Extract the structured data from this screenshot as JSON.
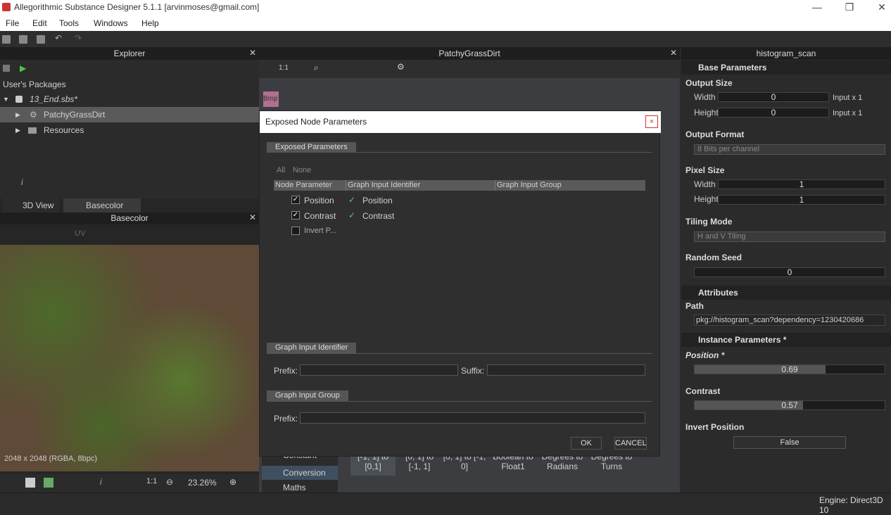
{
  "window": {
    "title": "Allegorithmic Substance Designer 5.1.1 [arvinmoses@gmail.com]"
  },
  "menu": [
    "File",
    "Edit",
    "Tools",
    "Windows",
    "Help"
  ],
  "explorer": {
    "title": "Explorer",
    "users_packages": "User's Packages",
    "package": "13_End.sbs*",
    "graph": "PatchyGrassDirt",
    "resources": "Resources"
  },
  "graph_view": {
    "title": "PatchyGrassDirt",
    "zoom_ratio": "1:1",
    "node_label": "Bmp"
  },
  "view2d": {
    "tab_3d": "3D View",
    "tab_basecolor": "Basecolor",
    "title": "Basecolor",
    "uv_label": "UV",
    "image_info": "2048 x 2048 (RGBA, 8bpc)",
    "zoom_ratio": "1:1",
    "zoom": "23.26%",
    "info_i": "i"
  },
  "library": {
    "items": [
      "Constant",
      "Conversion",
      "Maths"
    ],
    "tiles": [
      {
        "line1": "[-1, 1] to",
        "line2": "[0,1]"
      },
      {
        "line1": "[0, 1] to",
        "line2": "[-1, 1]"
      },
      {
        "line1": "[0, 1] to [-1,",
        "line2": "0]"
      },
      {
        "line1": "Boolean to",
        "line2": "Float1"
      },
      {
        "line1": "Degrees to",
        "line2": "Radians"
      },
      {
        "line1": "Degrees to",
        "line2": "Turns"
      }
    ]
  },
  "properties": {
    "title": "histogram_scan",
    "base_parameters": "Base Parameters",
    "output_size": {
      "label": "Output Size",
      "width_label": "Width",
      "width_value": "0",
      "width_suffix": "Input x 1",
      "height_label": "Height",
      "height_value": "0",
      "height_suffix": "Input x 1"
    },
    "output_format": {
      "label": "Output Format",
      "value": "8 Bits per channel"
    },
    "pixel_size": {
      "label": "Pixel Size",
      "width_label": "Width",
      "width_value": "1",
      "height_label": "Height",
      "height_value": "1"
    },
    "tiling_mode": {
      "label": "Tiling Mode",
      "value": "H and V Tiling"
    },
    "random_seed": {
      "label": "Random Seed",
      "value": "0"
    },
    "attributes": "Attributes",
    "path": {
      "label": "Path",
      "value": "pkg://histogram_scan?dependency=1230420686"
    },
    "instance_parameters": "Instance Parameters *",
    "position": {
      "label": "Position *",
      "value": "0.69",
      "fraction": 0.69
    },
    "contrast": {
      "label": "Contrast",
      "value": "0.57",
      "fraction": 0.57
    },
    "invert_position": {
      "label": "Invert Position",
      "value": "False"
    }
  },
  "dialog": {
    "title": "Exposed Node Parameters",
    "close": "×",
    "exposed_tab": "Exposed Parameters",
    "all": "All",
    "none": "None",
    "columns": [
      "Node Parameter",
      "Graph Input Identifier",
      "Graph Input Group"
    ],
    "rows": [
      {
        "param": "Position",
        "checked": true,
        "identifier": "Position"
      },
      {
        "param": "Contrast",
        "checked": true,
        "identifier": "Contrast"
      },
      {
        "param": "Invert P...",
        "checked": false,
        "identifier": ""
      }
    ],
    "identifier_section": "Graph Input Identifier",
    "prefix_label": "Prefix:",
    "suffix_label": "Suffix:",
    "group_section": "Graph Input Group",
    "group_prefix_label": "Prefix:",
    "ok": "OK",
    "cancel": "CANCEL"
  },
  "status": {
    "engine": "Engine: Direct3D 10"
  },
  "colors": {
    "accent": "#5c5c5c",
    "check_green": "#55cc55",
    "close_red": "#cc3333"
  }
}
